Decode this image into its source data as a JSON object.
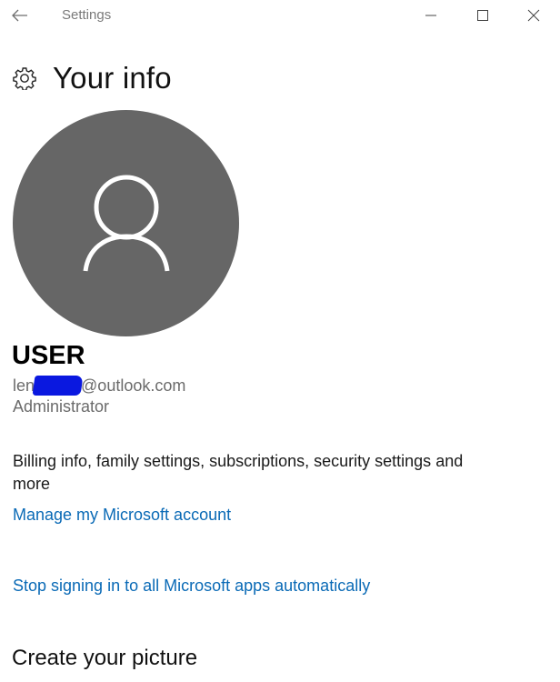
{
  "window": {
    "title": "Settings",
    "back_icon": "back-arrow-icon",
    "minimize_icon": "minimize-icon",
    "maximize_icon": "maximize-icon",
    "close_icon": "close-icon"
  },
  "header": {
    "icon": "gear-icon",
    "title": "Your info"
  },
  "account": {
    "avatar_icon": "person-icon",
    "avatar_color": "#666666",
    "name": "USER",
    "email_prefix": "len",
    "email_suffix": "@outlook.com",
    "role": "Administrator"
  },
  "billing": {
    "description": "Billing info, family settings, subscriptions, security settings and more",
    "manage_link": "Manage my Microsoft account"
  },
  "signin": {
    "stop_link": "Stop signing in to all Microsoft apps automatically"
  },
  "picture": {
    "heading": "Create your picture"
  },
  "colors": {
    "link": "#0a6ab6",
    "redaction": "#0a18e0"
  }
}
